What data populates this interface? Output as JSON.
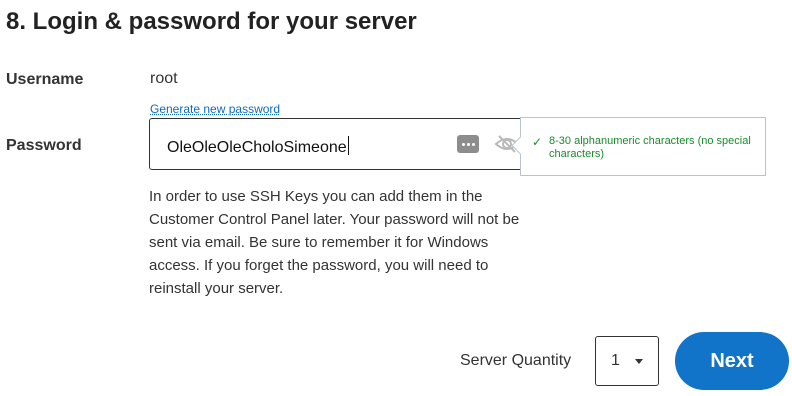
{
  "section": {
    "title": "8. Login & password for your server"
  },
  "username": {
    "label": "Username",
    "value": "root"
  },
  "password": {
    "label": "Password",
    "generate_link": "Generate new password",
    "value": "OleOleOleCholoSimeone",
    "icons": [
      "password-manager-dots-icon",
      "eye-slash-icon"
    ]
  },
  "hint": {
    "text": "8-30 alphanumeric characters (no special characters)",
    "color": "#1a8a2e"
  },
  "info": {
    "text": "In order to use SSH Keys you can add them in the Customer Control Panel later. Your password will not be sent via email. Be sure to remember it for Windows access. If you forget the password, you will need to reinstall your server."
  },
  "quantity": {
    "label": "Server Quantity",
    "value": "1"
  },
  "next_button": {
    "label": "Next",
    "color": "#1174c9"
  }
}
